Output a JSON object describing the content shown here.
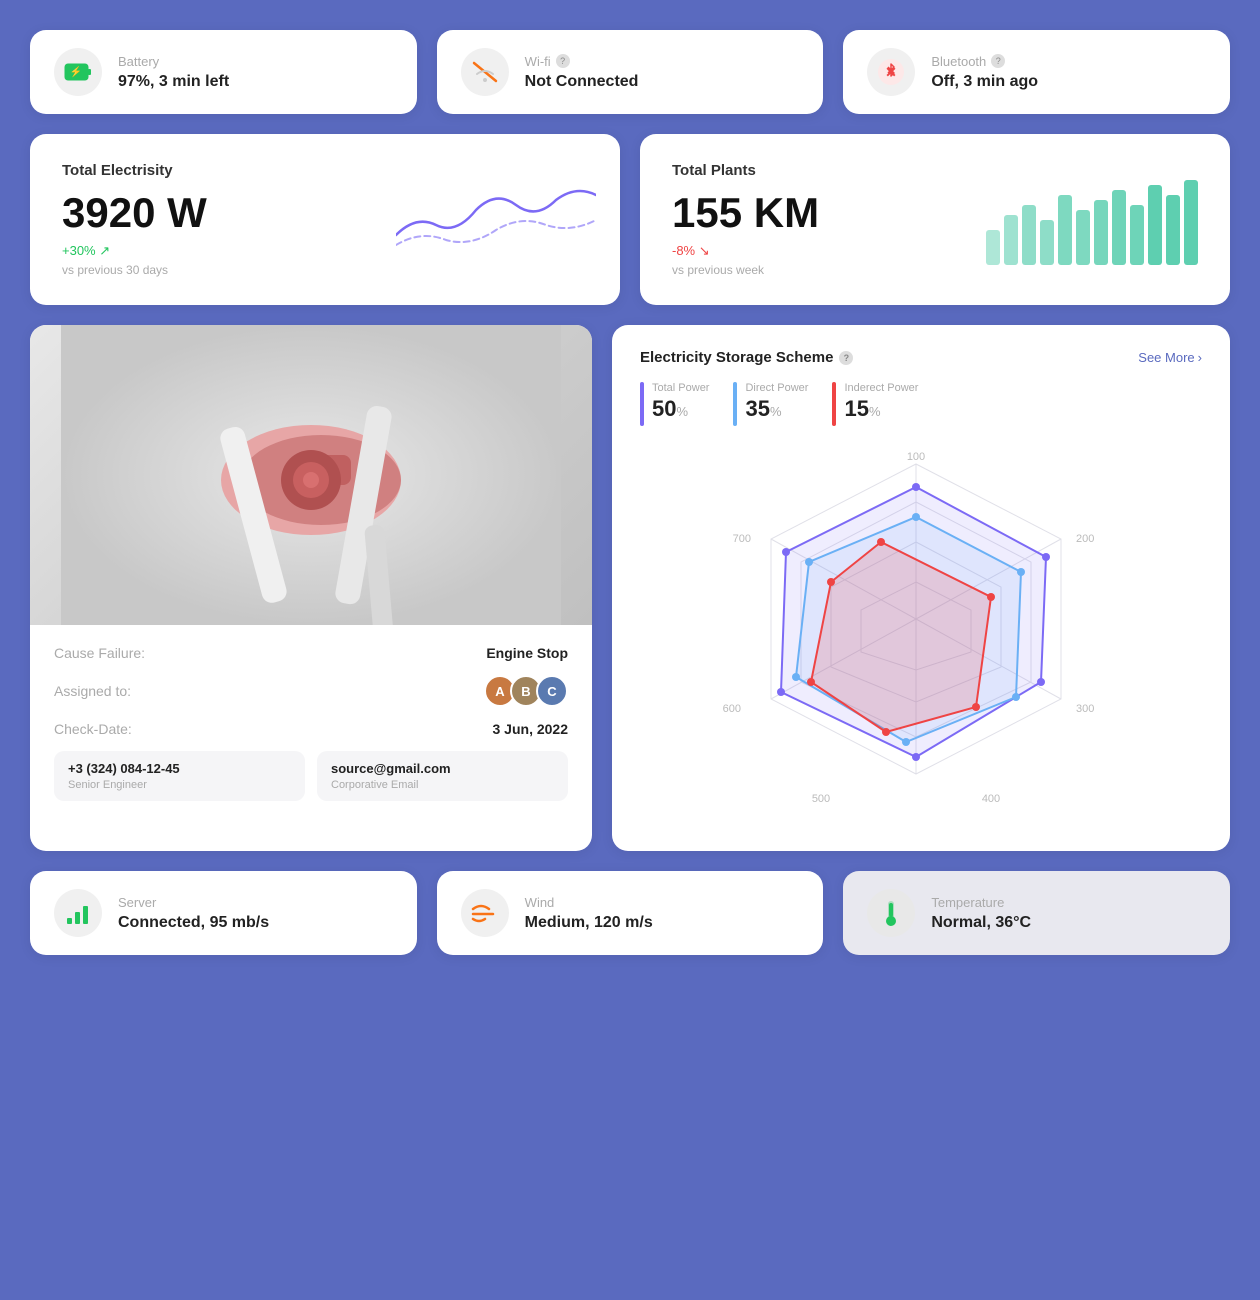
{
  "status_cards": [
    {
      "id": "battery",
      "label": "Battery",
      "value": "97%, 3 min left",
      "icon": "🔋",
      "icon_color": "#22c55e",
      "has_help": false
    },
    {
      "id": "wifi",
      "label": "Wi-fi",
      "value": "Not Connected",
      "icon": "📶",
      "has_help": true
    },
    {
      "id": "bluetooth",
      "label": "Bluetooth",
      "value": "Off, 3 min ago",
      "icon": "🦷",
      "has_help": true
    }
  ],
  "metrics": [
    {
      "id": "electricity",
      "title": "Total Electrisity",
      "value": "3920 W",
      "change": "+30%",
      "change_type": "positive",
      "sub": "vs previous 30 days",
      "chart_type": "line"
    },
    {
      "id": "plants",
      "title": "Total Plants",
      "value": "155 KM",
      "change": "-8%",
      "change_type": "negative",
      "sub": "vs previous week",
      "chart_type": "bar"
    }
  ],
  "turbine": {
    "cause_failure_label": "Cause Failure:",
    "cause_failure_value": "Engine Stop",
    "assigned_label": "Assigned to:",
    "check_date_label": "Check-Date:",
    "check_date_value": "3 Jun, 2022",
    "contact1": {
      "main": "+3 (324) 084-12-45",
      "sub": "Senior Engineer"
    },
    "contact2": {
      "main": "source@gmail.com",
      "sub": "Corporative Email"
    }
  },
  "radar": {
    "title": "Electricity Storage Scheme",
    "see_more": "See More",
    "legend": [
      {
        "label": "Total Power",
        "value": "50",
        "unit": "%",
        "color": "#7c6af5"
      },
      {
        "label": "Direct Power",
        "value": "35",
        "unit": "%",
        "color": "#6ab0f5"
      },
      {
        "label": "Inderect Power",
        "value": "15",
        "unit": "%",
        "color": "#ef4444"
      }
    ],
    "axes": [
      "100",
      "200",
      "300",
      "400",
      "500",
      "600",
      "700"
    ]
  },
  "bottom_cards": [
    {
      "id": "server",
      "label": "Server",
      "value": "Connected, 95 mb/s",
      "icon": "📶",
      "highlighted": false
    },
    {
      "id": "wind",
      "label": "Wind",
      "value": "Medium, 120 m/s",
      "icon": "💨",
      "highlighted": false
    },
    {
      "id": "temperature",
      "label": "Temperature",
      "value": "Normal, 36°C",
      "icon": "🌡️",
      "highlighted": true
    }
  ]
}
